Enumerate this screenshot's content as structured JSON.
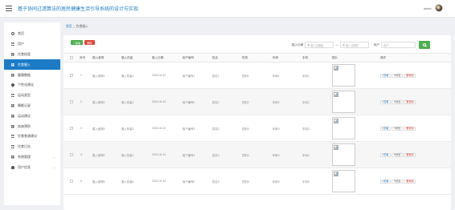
{
  "header": {
    "title": "基于协同过滤算法的居民健康生活引导系统的设计与实现",
    "user": "admin"
  },
  "sidebar": {
    "items": [
      {
        "label": "首页",
        "icon": "home-icon"
      },
      {
        "label": "用户",
        "icon": "grid-icon"
      },
      {
        "label": "饮食档案",
        "icon": "grid-icon"
      },
      {
        "label": "饮食摄入",
        "icon": "grid-icon"
      },
      {
        "label": "健康数据",
        "icon": "grid-icon"
      },
      {
        "label": "个性化建议",
        "icon": "drop-icon"
      },
      {
        "label": "运动类型",
        "icon": "grid-icon"
      },
      {
        "label": "睡眠记录",
        "icon": "grid-icon"
      },
      {
        "label": "运动建议",
        "icon": "grid-icon"
      },
      {
        "label": "疾病预防",
        "icon": "grid-icon"
      },
      {
        "label": "饮食食谱建议",
        "icon": "grid-icon"
      },
      {
        "label": "饮食日志",
        "icon": "grid-icon"
      },
      {
        "label": "系统管理",
        "icon": "grid-icon"
      },
      {
        "label": "用户信息",
        "icon": "user-icon"
      }
    ]
  },
  "breadcrumb": {
    "home": "首页",
    "sep": "/",
    "current": "饮食摄入"
  },
  "toolbar": {
    "add": "+ 新增",
    "delete": "删除"
  },
  "filters": {
    "date_label": "摄入日期",
    "start_placeholder": "摄入日期始",
    "end_placeholder": "摄入日期终",
    "dash": "—",
    "user_label": "用户",
    "user_placeholder": "用户"
  },
  "table": {
    "headers": [
      "序号",
      "摄入食物",
      "摄入热量",
      "摄入日期",
      "用户编号",
      "姓名",
      "性别",
      "年龄",
      "手机",
      "图片",
      "操作"
    ],
    "rows": [
      {
        "no": "1",
        "food": "摄入食物1",
        "cal": "摄入热量1",
        "date": "2024-04-10",
        "uid": "用户编号1",
        "name": "姓名1",
        "gender": "性别1",
        "age": "年龄1",
        "phone": "手机1"
      },
      {
        "no": "2",
        "food": "摄入食物2",
        "cal": "摄入热量2",
        "date": "2024-04-10",
        "uid": "用户编号2",
        "name": "姓名2",
        "gender": "性别2",
        "age": "年龄2",
        "phone": "手机2"
      },
      {
        "no": "3",
        "food": "摄入食物3",
        "cal": "摄入热量3",
        "date": "2024-04-10",
        "uid": "用户编号3",
        "name": "姓名3",
        "gender": "性别3",
        "age": "年龄3",
        "phone": "手机3"
      },
      {
        "no": "4",
        "food": "摄入食物4",
        "cal": "摄入热量4",
        "date": "2024-04-10",
        "uid": "用户编号4",
        "name": "姓名4",
        "gender": "性别4",
        "age": "年龄4",
        "phone": "手机4"
      },
      {
        "no": "5",
        "food": "摄入食物5",
        "cal": "摄入热量5",
        "date": "2024-04-10",
        "uid": "用户编号5",
        "name": "姓名5",
        "gender": "性别5",
        "age": "年龄5",
        "phone": "手机5"
      }
    ],
    "ops": {
      "view": "查看",
      "edit": "修改",
      "delete": "删除"
    }
  },
  "colors": {
    "primary": "#1b7bc7",
    "success": "#4cae4c",
    "danger": "#e0453a"
  }
}
